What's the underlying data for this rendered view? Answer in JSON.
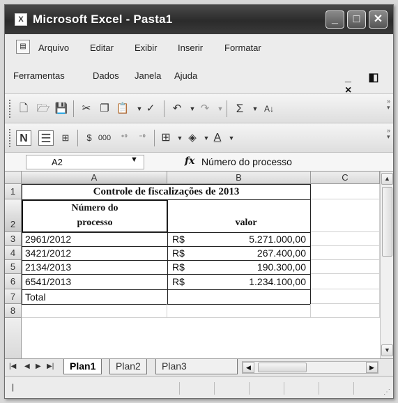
{
  "window": {
    "title": "Microsoft Excel - Pasta1",
    "app_icon": "X",
    "controls": {
      "minimize": "_",
      "maximize": "□",
      "close": "✕"
    }
  },
  "menu": {
    "items": [
      "Arquivo",
      "Editar",
      "Exibir",
      "Inserir",
      "Formatar",
      "Ferramentas",
      "Dados",
      "Janela",
      "Ajuda"
    ],
    "mdi_controls": "_ ◧ ×"
  },
  "toolbar_standard": {
    "sum_label": "Σ",
    "icons": [
      "new-file-icon",
      "open-folder-icon",
      "save-icon",
      "cut-icon",
      "copy-icon",
      "paste-icon",
      "format-painter-icon",
      "undo-icon",
      "redo-icon",
      "autosum-icon",
      "sort-ascending-icon"
    ]
  },
  "toolbar_formatting": {
    "bold_label": "N",
    "thousands_label": "000",
    "icons": [
      "bold-icon",
      "align-center-icon",
      "merge-center-icon",
      "currency-icon",
      "thousands-icon",
      "increase-decimal-icon",
      "decrease-decimal-icon",
      "borders-icon",
      "fill-color-icon",
      "font-color-icon"
    ]
  },
  "formula_bar": {
    "name_box": "A2",
    "fx": "fx",
    "content": "Número do processo"
  },
  "columns": [
    "A",
    "B",
    "C"
  ],
  "rows": [
    "1",
    "2",
    "3",
    "4",
    "5",
    "6",
    "7",
    "8"
  ],
  "sheet": {
    "title": "Controle de fiscalizações de 2013",
    "header_a": "Número do processo",
    "header_a_line1": "Número do",
    "header_a_line2": "processo",
    "header_b": "valor",
    "data": [
      {
        "processo": "2961/2012",
        "currency": "R$",
        "valor": "5.271.000,00"
      },
      {
        "processo": "3421/2012",
        "currency": "R$",
        "valor": "267.400,00"
      },
      {
        "processo": "2134/2013",
        "currency": "R$",
        "valor": "190.300,00"
      },
      {
        "processo": "6541/2013",
        "currency": "R$",
        "valor": "1.234.100,00"
      }
    ],
    "total_label": "Total"
  },
  "tabs": {
    "items": [
      "Plan1",
      "Plan2",
      "Plan3"
    ],
    "active": "Plan1"
  }
}
